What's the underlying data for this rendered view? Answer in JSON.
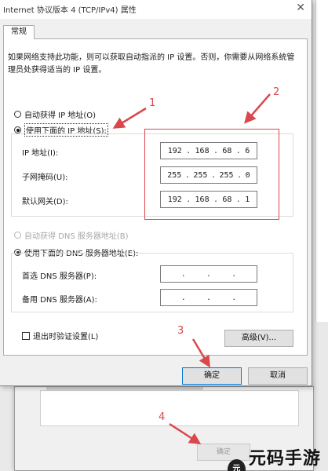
{
  "window": {
    "title": "Internet 协议版本 4 (TCP/IPv4) 属性",
    "close_glyph": "✕"
  },
  "tabs": [
    {
      "label": "常规"
    }
  ],
  "description": "如果网络支持此功能，则可以获取自动指派的 IP 设置。否则，你需要从网络系统管理员处获得适当的 IP 设置。",
  "ip_section": {
    "auto_label": "自动获得 IP 地址(O)",
    "manual_label": "使用下面的 IP 地址(S):",
    "manual_selected": true,
    "fields": [
      {
        "label": "IP 地址(I):",
        "octets": [
          "192",
          "168",
          "68",
          "6"
        ]
      },
      {
        "label": "子网掩码(U):",
        "octets": [
          "255",
          "255",
          "255",
          "0"
        ]
      },
      {
        "label": "默认网关(D):",
        "octets": [
          "192",
          "168",
          "68",
          "1"
        ]
      }
    ]
  },
  "dns_section": {
    "auto_label": "自动获得 DNS 服务器地址(B)",
    "auto_disabled": true,
    "manual_label": "使用下面的 DNS 服务器地址(E):",
    "manual_selected": true,
    "fields": [
      {
        "label": "首选 DNS 服务器(P):",
        "octets": [
          "",
          "",
          "",
          ""
        ]
      },
      {
        "label": "备用 DNS 服务器(A):",
        "octets": [
          "",
          "",
          "",
          ""
        ]
      }
    ]
  },
  "validate_label": "退出时验证设置(L)",
  "validate_checked": false,
  "buttons": {
    "advanced": "高级(V)...",
    "ok": "确定",
    "cancel": "取消"
  },
  "background_window": {
    "ok": "确定"
  },
  "annotations": {
    "step1": "1",
    "step2": "2",
    "step3": "3",
    "step4": "4",
    "color": "#d9484c"
  },
  "watermark": {
    "text": "元码手游网",
    "logo": "元"
  }
}
